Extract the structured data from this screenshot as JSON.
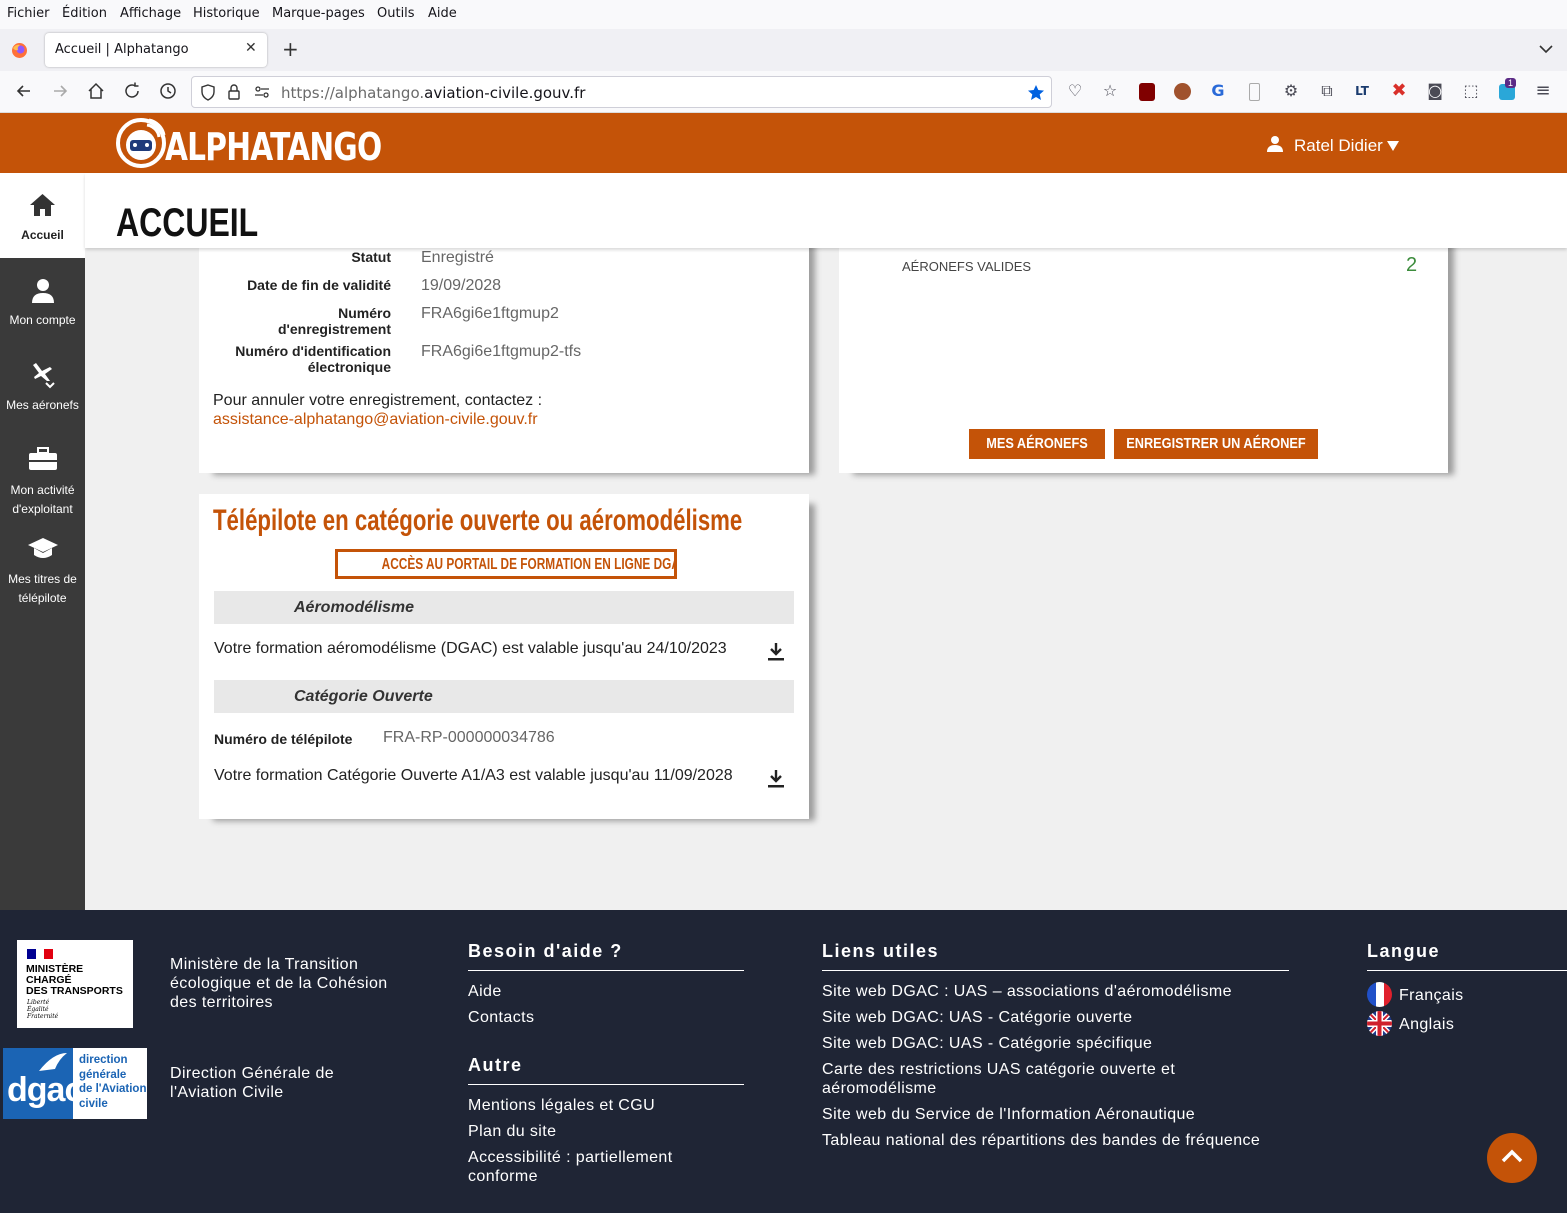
{
  "browser": {
    "menu": [
      "Fichier",
      "Édition",
      "Affichage",
      "Historique",
      "Marque-pages",
      "Outils",
      "Aide"
    ],
    "tab_title": "Accueil | Alphatango",
    "url_prefix": "https://alphatango.",
    "url_domain": "aviation-civile.gouv.fr",
    "badge_count": "1"
  },
  "header": {
    "logo_text": "ALPHATANGO",
    "user_name": "Ratel Didier"
  },
  "sidebar": {
    "items": [
      {
        "label": "Accueil",
        "icon": "home-icon"
      },
      {
        "label": "Mon compte",
        "icon": "user-icon"
      },
      {
        "label": "Mes aéronefs",
        "icon": "drone-icon"
      },
      {
        "label": "Mon activité d'exploitant",
        "icon": "briefcase-icon"
      },
      {
        "label": "Mes titres de télépilote",
        "icon": "graduation-cap-icon"
      }
    ]
  },
  "page_title": "ACCUEIL",
  "registration_card": {
    "fields": [
      {
        "label": "Statut",
        "value": "Enregistré"
      },
      {
        "label": "Date de fin de validité",
        "value": "19/09/2028"
      },
      {
        "label": "Numéro d'enregistrement",
        "value": "FRA6gi6e1ftgmup2"
      },
      {
        "label": "Numéro d'identification électronique",
        "value": "FRA6gi6e1ftgmup2-tfs"
      }
    ],
    "cancel_text": "Pour annuler votre enregistrement, contactez :",
    "cancel_email": "assistance-alphatango@aviation-civile.gouv.fr"
  },
  "aircraft_card": {
    "valid_label": "AÉRONEFS VALIDES",
    "valid_count": "2",
    "btn_my_aircraft": "MES AÉRONEFS",
    "btn_register": "ENREGISTRER UN AÉRONEF"
  },
  "pilot_card": {
    "title": "Télépilote en catégorie ouverte ou aéromodélisme",
    "portal_button": "ACCÈS AU PORTAIL DE FORMATION EN LIGNE DGAC",
    "section1_title": "Aéromodélisme",
    "section1_text": "Votre formation aéromodélisme (DGAC) est valable jusqu'au 24/10/2023",
    "section2_title": "Catégorie Ouverte",
    "pilot_number_label": "Numéro de télépilote",
    "pilot_number_value": "FRA-RP-000000034786",
    "section2_text": "Votre formation Catégorie Ouverte A1/A3 est valable jusqu'au 11/09/2028"
  },
  "footer": {
    "ministry_logo_lines": [
      "MINISTÈRE",
      "CHARGÉ",
      "DES TRANSPORTS"
    ],
    "ministry_motto": [
      "Liberté",
      "Égalité",
      "Fraternité"
    ],
    "ministry_name": "Ministère de la Transition écologique et de la Cohésion des territoires",
    "dgac_logo_text": "dgac",
    "dgac_logo_lines": [
      "direction",
      "générale",
      "de l'Aviation",
      "civile"
    ],
    "dgac_name": "Direction Générale de l'Aviation Civile",
    "help_title": "Besoin d'aide ?",
    "help_links": [
      "Aide",
      "Contacts"
    ],
    "other_title": "Autre",
    "other_links": [
      "Mentions légales et CGU",
      "Plan du site",
      "Accessibilité : partiellement conforme"
    ],
    "useful_title": "Liens utiles",
    "useful_links": [
      "Site web DGAC : UAS – associations d'aéromodélisme",
      "Site web DGAC: UAS - Catégorie ouverte",
      "Site web DGAC: UAS - Catégorie spécifique",
      "Carte des restrictions UAS catégorie ouverte et aéromodélisme",
      "Site web du Service de l'Information Aéronautique",
      "Tableau national des répartitions des bandes de fréquence"
    ],
    "lang_title": "Langue",
    "languages": [
      "Français",
      "Anglais"
    ]
  },
  "colors": {
    "brand_orange": "#c45308",
    "sidebar_dark": "#3a3a3a",
    "footer_navy": "#1f2535",
    "valid_green": "#3c8c3c"
  }
}
